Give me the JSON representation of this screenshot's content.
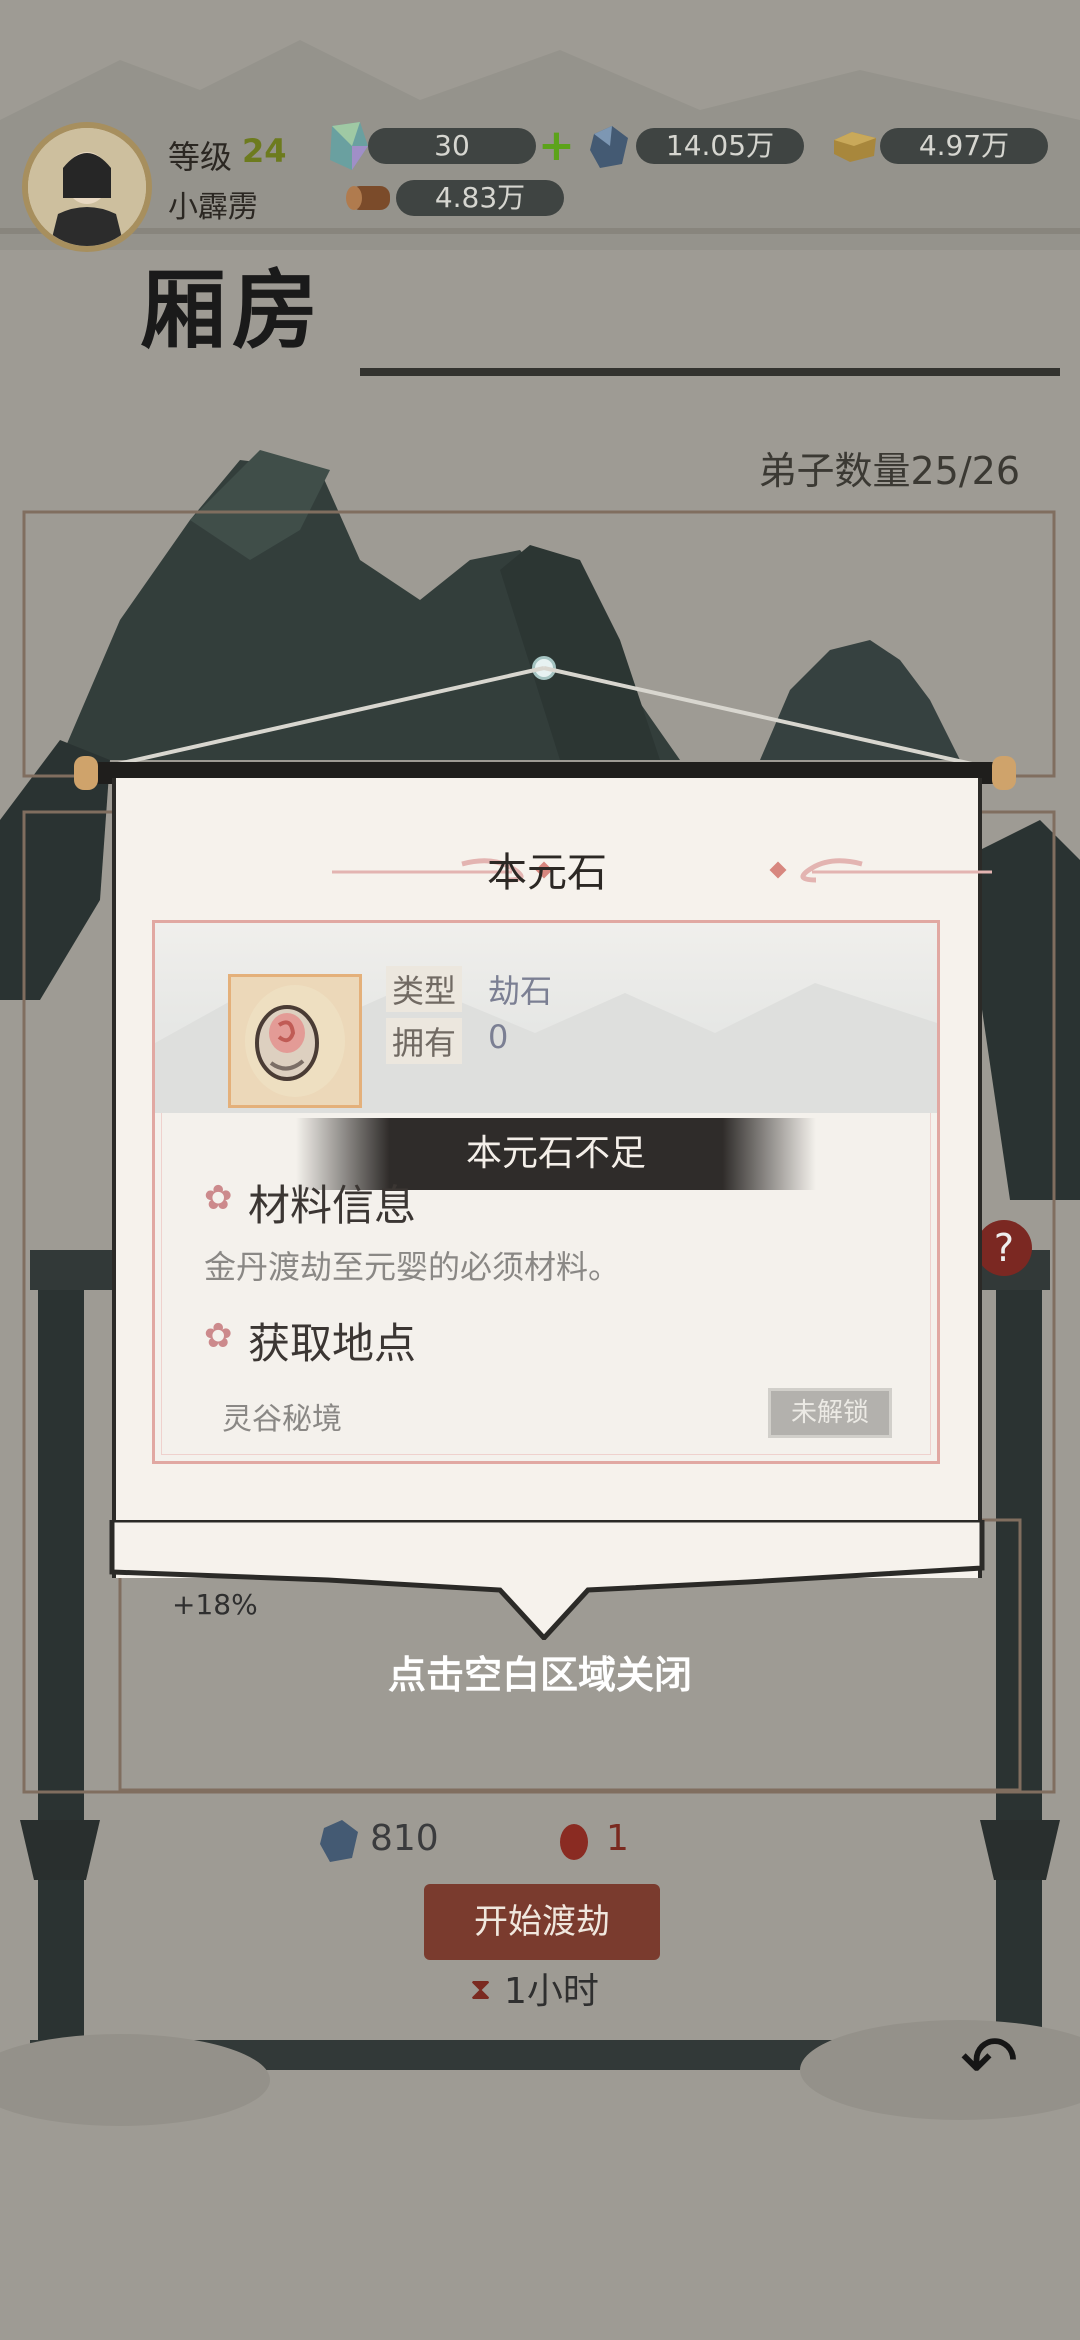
{
  "player": {
    "level_label": "等级",
    "level": "24",
    "name": "小霹雳"
  },
  "resources": {
    "spirit_gem": "30",
    "spirit_stone": "14.05万",
    "gold": "4.97万",
    "wood": "4.83万"
  },
  "page": {
    "title": "厢房",
    "disciple_count": "弟子数量25/26",
    "cost_stone": "810",
    "cost_core": "1",
    "start_button": "开始渡劫",
    "duration": "1小时",
    "bonus": "+18%"
  },
  "modal": {
    "title": "本元石",
    "type_label": "类型",
    "type_value": "劫石",
    "own_label": "拥有",
    "own_value": "0",
    "banner": "本元石不足",
    "info_title": "材料信息",
    "info_desc": "金丹渡劫至元婴的必须材料。",
    "source_title": "获取地点",
    "source_name": "灵谷秘境",
    "source_status": "未解锁",
    "close_hint": "点击空白区域关闭"
  },
  "colors": {
    "accent_red": "#7a3b2e",
    "frame_pink": "#e1a8a2",
    "level_green": "#6d7b1e",
    "banner_dark": "#2f2c2a"
  }
}
